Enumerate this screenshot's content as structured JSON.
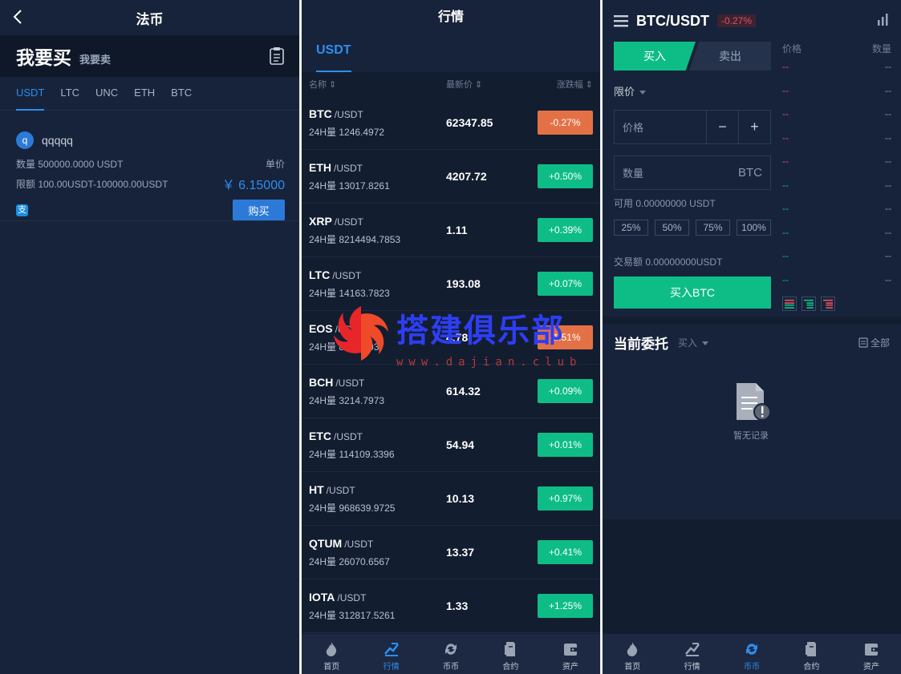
{
  "fiat": {
    "title": "法币",
    "buy_tab": "我要买",
    "sell_tab": "我要卖",
    "coins": [
      "USDT",
      "LTC",
      "UNC",
      "ETH",
      "BTC"
    ],
    "ad": {
      "avatar": "q",
      "user": "qqqqq",
      "quantity": "数量 500000.0000 USDT",
      "unit_price_label": "单价",
      "limit": "限额 100.00USDT-100000.00USDT",
      "price": "￥ 6.15000",
      "pay_icon": "支",
      "buy_label": "购买"
    }
  },
  "market": {
    "title": "行情",
    "tab": "USDT",
    "col_name": "名称",
    "col_price": "最新价",
    "col_change": "涨跌幅",
    "rows": [
      {
        "symbol": "BTC",
        "quote": "/USDT",
        "volume": "24H量 1246.4972",
        "price": "62347.85",
        "change": "-0.27%",
        "dir": "down"
      },
      {
        "symbol": "ETH",
        "quote": "/USDT",
        "volume": "24H量 13017.8261",
        "price": "4207.72",
        "change": "+0.50%",
        "dir": "up"
      },
      {
        "symbol": "XRP",
        "quote": "/USDT",
        "volume": "24H量 8214494.7853",
        "price": "1.11",
        "change": "+0.39%",
        "dir": "up"
      },
      {
        "symbol": "LTC",
        "quote": "/USDT",
        "volume": "24H量 14163.7823",
        "price": "193.08",
        "change": "+0.07%",
        "dir": "up"
      },
      {
        "symbol": "EOS",
        "quote": "/USDT",
        "volume": "24H量 8.........03",
        "price": "4.78",
        "change": "-1.51%",
        "dir": "down"
      },
      {
        "symbol": "BCH",
        "quote": "/USDT",
        "volume": "24H量 3214.7973",
        "price": "614.32",
        "change": "+0.09%",
        "dir": "up"
      },
      {
        "symbol": "ETC",
        "quote": "/USDT",
        "volume": "24H量 114109.3396",
        "price": "54.94",
        "change": "+0.01%",
        "dir": "up"
      },
      {
        "symbol": "HT",
        "quote": "/USDT",
        "volume": "24H量 968639.9725",
        "price": "10.13",
        "change": "+0.97%",
        "dir": "up"
      },
      {
        "symbol": "QTUM",
        "quote": "/USDT",
        "volume": "24H量 26070.6567",
        "price": "13.37",
        "change": "+0.41%",
        "dir": "up"
      },
      {
        "symbol": "IOTA",
        "quote": "/USDT",
        "volume": "24H量 312817.5261",
        "price": "1.33",
        "change": "+1.25%",
        "dir": "up"
      }
    ]
  },
  "watermark": {
    "text": "搭建俱乐部",
    "url": "www.dajian.club"
  },
  "trade": {
    "pair": "BTC/USDT",
    "change": "-0.27%",
    "buy_tab": "买入",
    "sell_tab": "卖出",
    "order_type": "限价",
    "price_placeholder": "价格",
    "minus": "−",
    "plus": "+",
    "qty_placeholder": "数量",
    "qty_unit": "BTC",
    "available": "可用 0.00000000 USDT",
    "percents": [
      "25%",
      "50%",
      "75%",
      "100%"
    ],
    "amount": "交易额 0.00000000USDT",
    "submit": "买入BTC",
    "book_price": "价格",
    "book_qty": "数量",
    "asks": [
      [
        "--",
        "--"
      ],
      [
        "--",
        "--"
      ],
      [
        "--",
        "--"
      ],
      [
        "--",
        "--"
      ],
      [
        "--",
        "--"
      ]
    ],
    "bids": [
      [
        "--",
        "--"
      ],
      [
        "--",
        "--"
      ],
      [
        "--",
        "--"
      ],
      [
        "--",
        "--"
      ],
      [
        "--",
        "--"
      ]
    ],
    "orders_title": "当前委托",
    "orders_filter": "买入",
    "orders_all": "全部",
    "empty": "暂无记录"
  },
  "tabbar": [
    {
      "label": "首页",
      "icon": "home-flame-icon"
    },
    {
      "label": "行情",
      "icon": "market-chart-icon"
    },
    {
      "label": "币币",
      "icon": "exchange-refresh-icon"
    },
    {
      "label": "合约",
      "icon": "contract-doc-icon"
    },
    {
      "label": "资产",
      "icon": "wallet-icon"
    }
  ],
  "colors": {
    "up": "#0ebd85",
    "down": "#e47146",
    "accent": "#2b8ff0",
    "bg": "#17233a"
  }
}
